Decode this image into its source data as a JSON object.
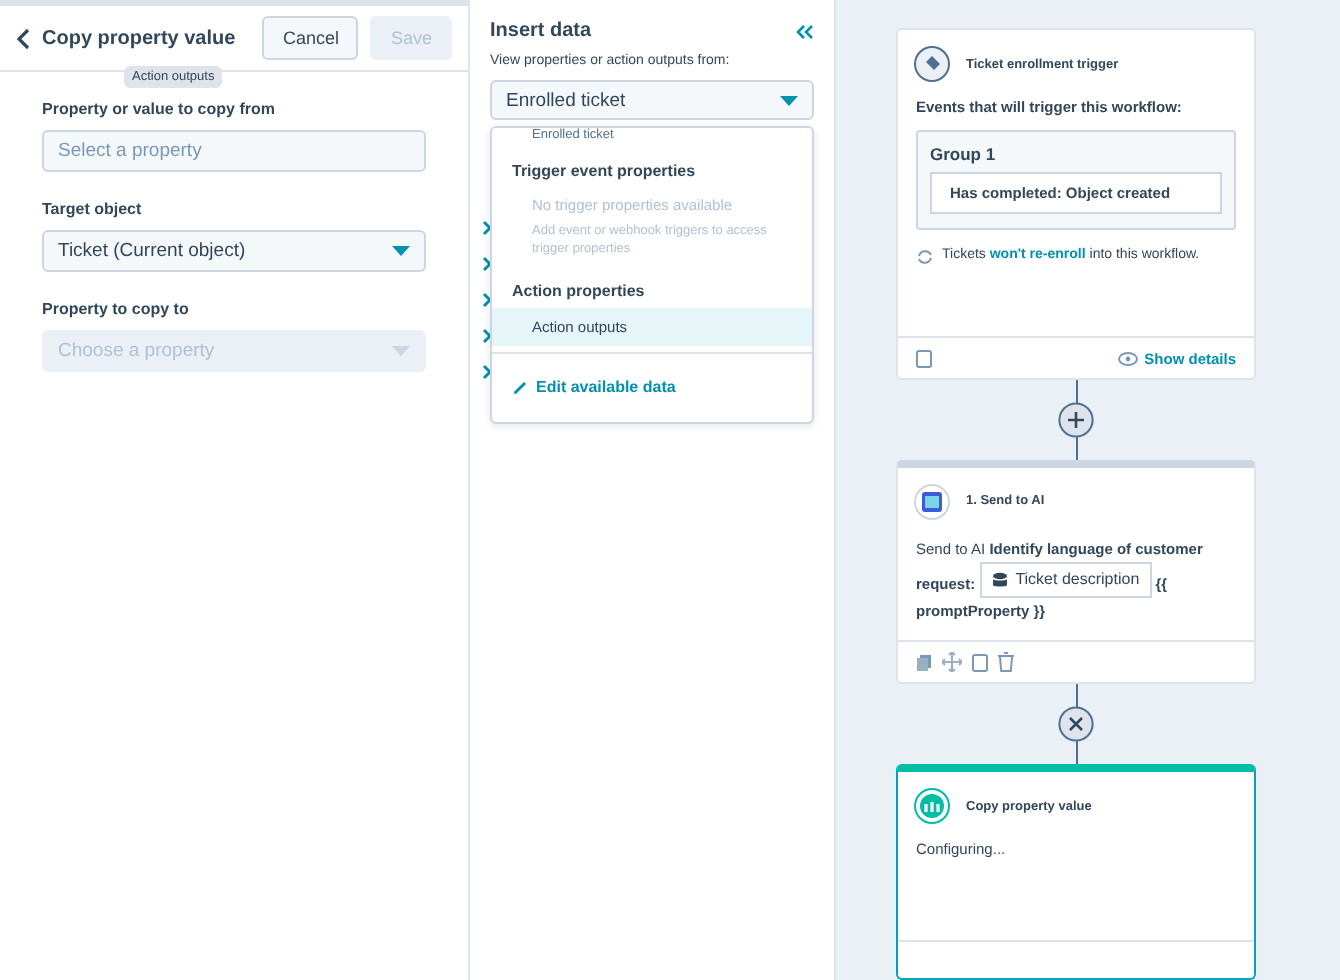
{
  "editor": {
    "title": "Copy property value",
    "tooltip": "Action outputs",
    "buttons": [
      {
        "label": "Cancel",
        "disabled": false
      },
      {
        "label": "Save",
        "disabled": true
      }
    ],
    "fields": [
      {
        "kind": "input",
        "label": "Property or value to copy from",
        "placeholder": "Select a property",
        "disabled": false
      },
      {
        "kind": "select",
        "label": "Target object",
        "value": "Ticket (Current object)",
        "disabled": false
      },
      {
        "kind": "select",
        "label": "Property to copy to",
        "placeholder": "Choose a property",
        "disabled": true
      }
    ]
  },
  "insert_panel": {
    "title": "Insert data",
    "source_label": "View properties or action outputs from:",
    "source_value": "Enrolled ticket",
    "menu": [
      {
        "kind": "option",
        "text": "Enrolled ticket",
        "selected": false
      },
      {
        "kind": "heading",
        "text": "Trigger event properties"
      },
      {
        "kind": "empty",
        "text": "No trigger properties available"
      },
      {
        "kind": "hint",
        "text": "Add event or webhook triggers to access trigger properties"
      },
      {
        "kind": "heading",
        "text": "Action properties"
      },
      {
        "kind": "option",
        "text": "Action outputs",
        "selected": true
      },
      {
        "kind": "action",
        "text": "Edit available data"
      }
    ]
  },
  "canvas": {
    "trigger": {
      "title": "Ticket enrollment trigger",
      "subtitle": "Events that will trigger this workflow:",
      "group": "Group 1",
      "condition": "Has completed: Object created",
      "reenroll_before": "Tickets",
      "reenroll_link": "won't re-enroll",
      "reenroll_after": "into this workflow.",
      "details_link": "Show details"
    },
    "connectors": [
      {
        "kind": "add"
      },
      {
        "kind": "close"
      }
    ],
    "ai_action": {
      "title": "1. Send to AI",
      "text_before": "Send to AI **Identify language of customer request:**",
      "token": "Ticket description",
      "text_after": "**{{ promptProperty }}**"
    },
    "current_action": {
      "title": "Copy property value",
      "status": "Configuring...",
      "selected": true
    }
  }
}
